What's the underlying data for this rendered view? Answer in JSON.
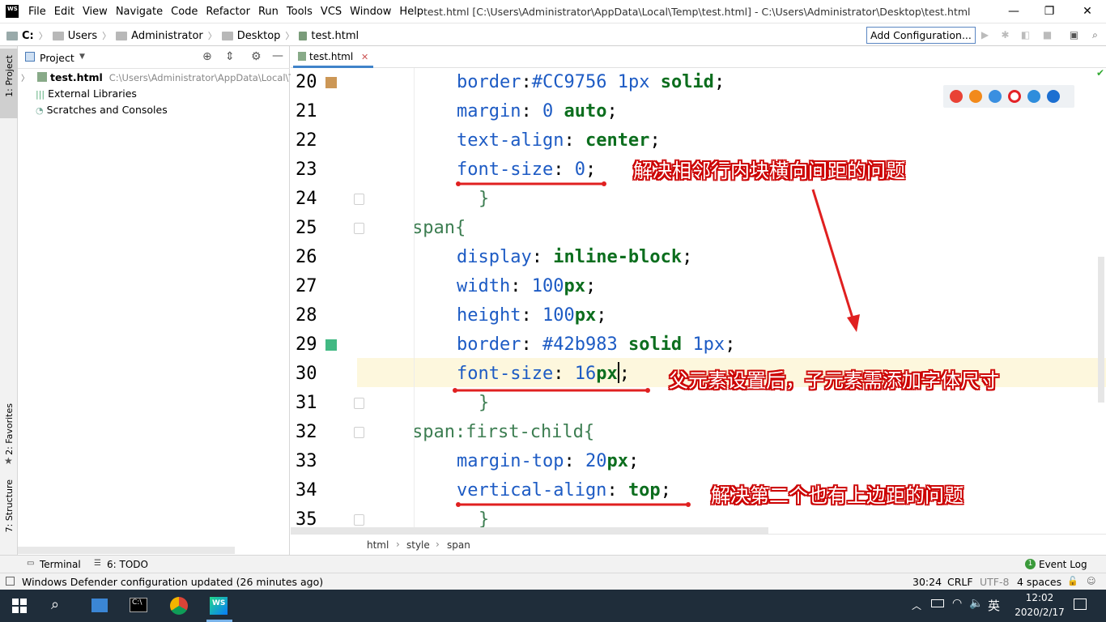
{
  "titlebar": {
    "logo": "WS",
    "menu": [
      "File",
      "Edit",
      "View",
      "Navigate",
      "Code",
      "Refactor",
      "Run",
      "Tools",
      "VCS",
      "Window",
      "Help"
    ],
    "title": "test.html [C:\\Users\\Administrator\\AppData\\Local\\Temp\\test.html] - C:\\Users\\Administrator\\Desktop\\test.html",
    "minimize": "—",
    "restore": "❐",
    "close": "✕"
  },
  "navbar": {
    "crumbs": [
      "C:",
      "Users",
      "Administrator",
      "Desktop",
      "test.html"
    ],
    "add_config": "Add Configuration..."
  },
  "left_strip": {
    "project": "1: Project",
    "favorites": "2: Favorites",
    "structure": "7: Structure"
  },
  "project": {
    "header": "Project",
    "file_name": "test.html",
    "file_path": "C:\\Users\\Administrator\\AppData\\Local\\T",
    "external": "External Libraries",
    "scratches": "Scratches and Consoles"
  },
  "editor": {
    "tab_label": "test.html",
    "line_numbers": [
      "20",
      "21",
      "22",
      "23",
      "24",
      "25",
      "26",
      "27",
      "28",
      "29",
      "30",
      "31",
      "32",
      "33",
      "34",
      "35"
    ],
    "line20": {
      "prop": "border",
      "sep": ":",
      "val1": "#CC9756 ",
      "num": "1px",
      "val2": " solid",
      "end": ";"
    },
    "line21": {
      "prop": "margin",
      "sep": ": ",
      "num": "0",
      "val": " auto",
      "end": ";"
    },
    "line22": {
      "prop": "text-align",
      "sep": ": ",
      "val": "center",
      "end": ";"
    },
    "line23": {
      "prop": "font-size",
      "sep": ": ",
      "num": "0",
      "end": ";"
    },
    "line24": "}",
    "line25": "span{",
    "line26": {
      "prop": "display",
      "sep": ": ",
      "val": "inline-block",
      "end": ";"
    },
    "line27": {
      "prop": "width",
      "sep": ": ",
      "num": "100",
      "unit": "px",
      "end": ";"
    },
    "line28": {
      "prop": "height",
      "sep": ": ",
      "num": "100",
      "unit": "px",
      "end": ";"
    },
    "line29": {
      "prop": "border",
      "sep": ": ",
      "val1": "#42b983 ",
      "val2": "solid ",
      "num": "1px",
      "end": ";"
    },
    "line30": {
      "prop": "font-size",
      "sep": ": ",
      "num": "16",
      "unit": "px",
      "end": ";"
    },
    "line31": "}",
    "line32": "span:first-child{",
    "line33": {
      "prop": "margin-top",
      "sep": ": ",
      "num": "20",
      "unit": "px",
      "end": ";"
    },
    "line34": {
      "prop": "vertical-align",
      "sep": ": ",
      "val": "top",
      "end": ";"
    },
    "line35": "}",
    "swatch1_color": "#CC9756",
    "swatch2_color": "#42b983",
    "breadcrumb": [
      "html",
      "style",
      "span"
    ]
  },
  "annotations": {
    "a1": "解决相邻行内块横向间距的问题",
    "a2": "父元素设置后，子元素需添加字体尺寸",
    "a3": "解决第二个也有上边距的问题",
    "arrow_color": "#e02020"
  },
  "bottom": {
    "terminal": "Terminal",
    "todo": "6: TODO",
    "event_log": "Event Log",
    "event_count": "1"
  },
  "status": {
    "message": "Windows Defender configuration updated (26 minutes ago)",
    "position": "30:24",
    "line_sep": "CRLF",
    "encoding": "UTF-8",
    "indent": "4 spaces"
  },
  "taskbar": {
    "ime": "英",
    "time": "12:02",
    "date": "2020/2/17"
  }
}
